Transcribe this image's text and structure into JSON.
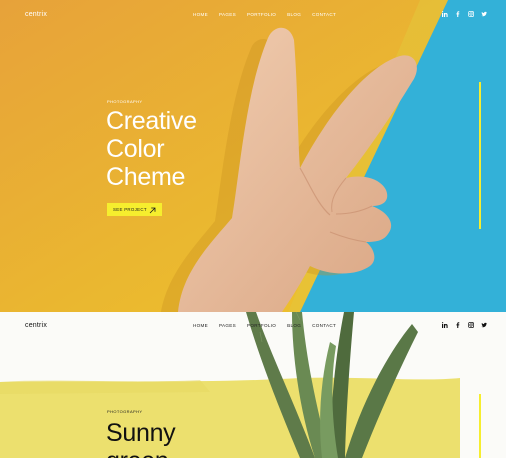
{
  "colors": {
    "yellow": "#eab72f",
    "orange": "#e49a2e",
    "blue": "#33b1d8",
    "accent": "#f6ee2e",
    "green": "#5f7b4a",
    "paper": "#fbfbf8",
    "band": "#ece06e"
  },
  "hero": {
    "logo": "centrix",
    "nav": [
      "HOME",
      "PAGES",
      "PORTFOLIO",
      "BLOG",
      "CONTACT"
    ],
    "social_icons": [
      "linkedin-icon",
      "facebook-icon",
      "instagram-icon",
      "twitter-icon"
    ],
    "eyebrow": "PHOTOGRAPHY",
    "title": "Creative\nColor\nCheme",
    "button_label": "SEE PROJECT",
    "button_icon": "arrow-up-right-icon"
  },
  "second": {
    "logo": "centrix",
    "nav": [
      "HOME",
      "PAGES",
      "PORTFOLIO",
      "BLOG",
      "CONTACT"
    ],
    "social_icons": [
      "linkedin-icon",
      "facebook-icon",
      "instagram-icon",
      "twitter-icon"
    ],
    "eyebrow": "PHOTOGRAPHY",
    "title": "Sunny\ngreen"
  }
}
